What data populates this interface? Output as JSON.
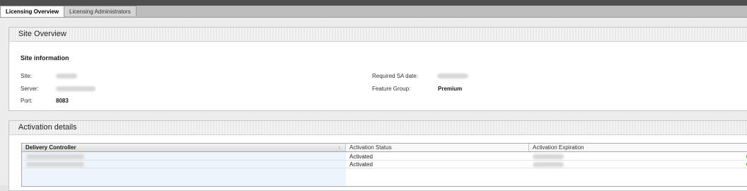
{
  "tabs": [
    {
      "label": "Licensing Overview",
      "active": true
    },
    {
      "label": "Licensing Administrators",
      "active": false
    }
  ],
  "site_overview": {
    "title": "Site Overview",
    "subheading": "Site information",
    "site_label": "Site:",
    "server_label": "Server:",
    "port_label": "Port:",
    "port_value": "8083",
    "required_sa_label": "Required SA date:",
    "feature_group_label": "Feature Group:",
    "feature_group_value": "Premium"
  },
  "activation": {
    "title": "Activation details",
    "columns": [
      "Delivery Controller",
      "Activation Status",
      "Activation Expiration"
    ],
    "rows": [
      {
        "status": "Activated"
      },
      {
        "status": "Activated"
      }
    ]
  },
  "colors": {
    "status_ok": "#4caf2d"
  },
  "icons": [
    "sort-icon",
    "check-circle-icon"
  ]
}
